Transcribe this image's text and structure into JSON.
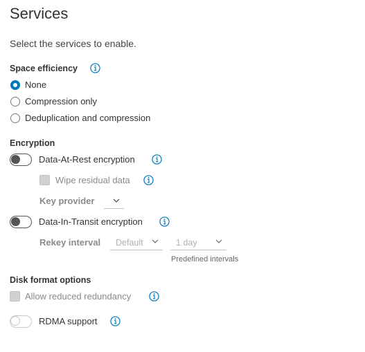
{
  "page": {
    "title": "Services",
    "subtitle": "Select the services to enable."
  },
  "space_efficiency": {
    "label": "Space efficiency",
    "options": [
      {
        "label": "None",
        "selected": true
      },
      {
        "label": "Compression only",
        "selected": false
      },
      {
        "label": "Deduplication and compression",
        "selected": false
      }
    ]
  },
  "encryption": {
    "label": "Encryption",
    "data_at_rest": {
      "label": "Data-At-Rest encryption",
      "enabled": false
    },
    "wipe_residual": {
      "label": "Wipe residual data",
      "checked": false
    },
    "key_provider": {
      "label": "Key provider",
      "value": ""
    },
    "data_in_transit": {
      "label": "Data-In-Transit encryption",
      "enabled": false
    },
    "rekey_interval": {
      "label": "Rekey interval",
      "value": "Default",
      "interval_value": "1 day",
      "hint": "Predefined intervals"
    }
  },
  "disk_format": {
    "label": "Disk format options",
    "reduced_redundancy": {
      "label": "Allow reduced redundancy",
      "checked": false
    },
    "rdma": {
      "label": "RDMA support",
      "enabled": false
    }
  },
  "icons": {
    "info": "info-icon",
    "chevron": "chevron-down-icon"
  },
  "colors": {
    "accent": "#0079b8",
    "text": "#333333",
    "disabled": "#8a8a8a"
  }
}
